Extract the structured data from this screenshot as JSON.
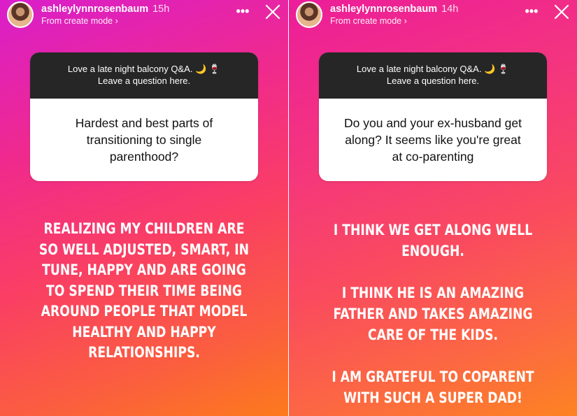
{
  "stories": [
    {
      "username": "ashleylynnrosenbaum",
      "time": "15h",
      "subline": "From create mode ›",
      "sticker_line1": "Love a late night balcony Q&A.",
      "sticker_line2": "Leave a question here.",
      "question": "Hardest and best parts of transitioning to single parenthood?",
      "answer": "REALIZING MY CHILDREN ARE SO WELL ADJUSTED, SMART, IN TUNE, HAPPY AND ARE GOING TO SPEND THEIR TIME BEING AROUND PEOPLE THAT MODEL HEALTHY AND HAPPY RELATIONSHIPS."
    },
    {
      "username": "ashleylynnrosenbaum",
      "time": "14h",
      "subline": "From create mode ›",
      "sticker_line1": "Love a late night balcony Q&A.",
      "sticker_line2": "Leave a question here.",
      "question": "Do you and your ex-husband get along? It seems like you're great at co-parenting",
      "answer_p1": "I THINK WE GET ALONG WELL ENOUGH.",
      "answer_p2": "I THINK HE IS AN AMAZING FATHER AND TAKES AMAZING CARE OF THE KIDS.",
      "answer_p3": "I AM GRATEFUL TO COPARENT WITH SUCH A SUPER DAD!"
    }
  ],
  "icons": {
    "more": "more-options-icon",
    "close": "close-icon",
    "moon": "moon-icon",
    "wine": "wine-glass-icon"
  },
  "colors": {
    "sticker_header": "#262626",
    "text": "#ffffff"
  }
}
